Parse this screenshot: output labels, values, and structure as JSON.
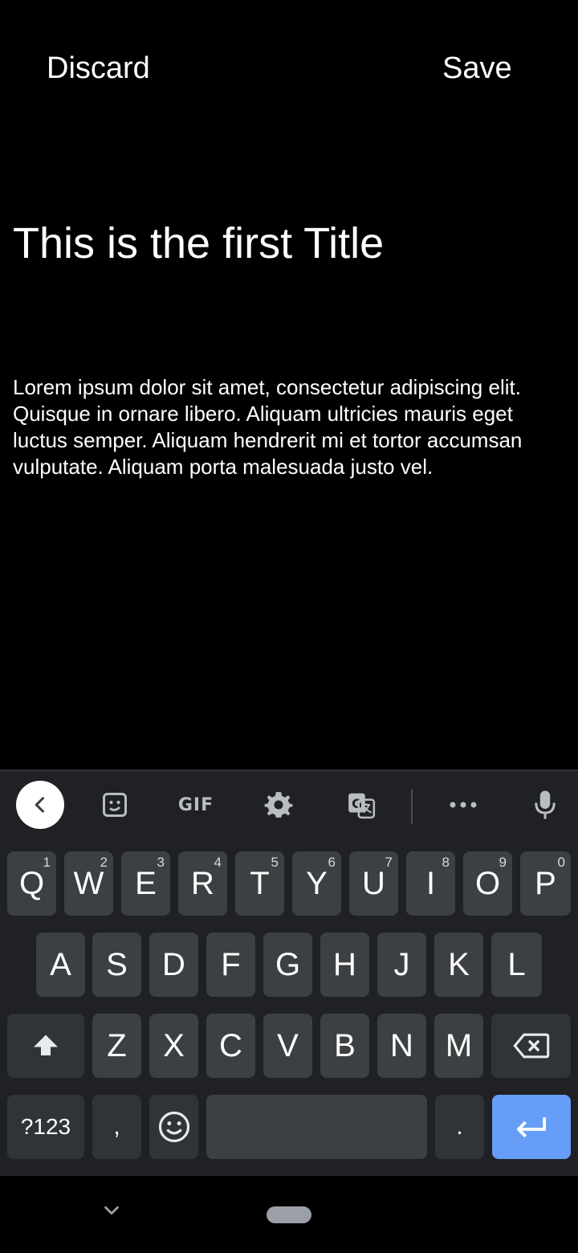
{
  "header": {
    "discard_label": "Discard",
    "save_label": "Save"
  },
  "note": {
    "title": "This is the first Title",
    "body": "Lorem ipsum dolor sit amet, consectetur adipiscing elit. Quisque in ornare libero. Aliquam ultricies mauris eget luctus semper. Aliquam hendrerit mi et tortor accumsan vulputate. Aliquam porta malesuada justo vel."
  },
  "keyboard": {
    "toolbar": {
      "items": [
        "back-chevron-icon",
        "sticker-icon",
        "gif",
        "gear-icon",
        "translate-icon",
        "more-icon",
        "mic-icon"
      ],
      "gif_label": "GIF"
    },
    "row1": [
      {
        "label": "Q",
        "hint": "1"
      },
      {
        "label": "W",
        "hint": "2"
      },
      {
        "label": "E",
        "hint": "3"
      },
      {
        "label": "R",
        "hint": "4"
      },
      {
        "label": "T",
        "hint": "5"
      },
      {
        "label": "Y",
        "hint": "6"
      },
      {
        "label": "U",
        "hint": "7"
      },
      {
        "label": "I",
        "hint": "8"
      },
      {
        "label": "O",
        "hint": "9"
      },
      {
        "label": "P",
        "hint": "0"
      }
    ],
    "row2": [
      "A",
      "S",
      "D",
      "F",
      "G",
      "H",
      "J",
      "K",
      "L"
    ],
    "row3": [
      "Z",
      "X",
      "C",
      "V",
      "B",
      "N",
      "M"
    ],
    "symbols_label": "?123",
    "comma_label": ",",
    "period_label": ".",
    "colors": {
      "background": "#202124",
      "key": "#3c4043",
      "enter": "#669df6"
    }
  },
  "nav": {
    "icons": [
      "chevron-down-icon",
      "home-pill"
    ]
  }
}
